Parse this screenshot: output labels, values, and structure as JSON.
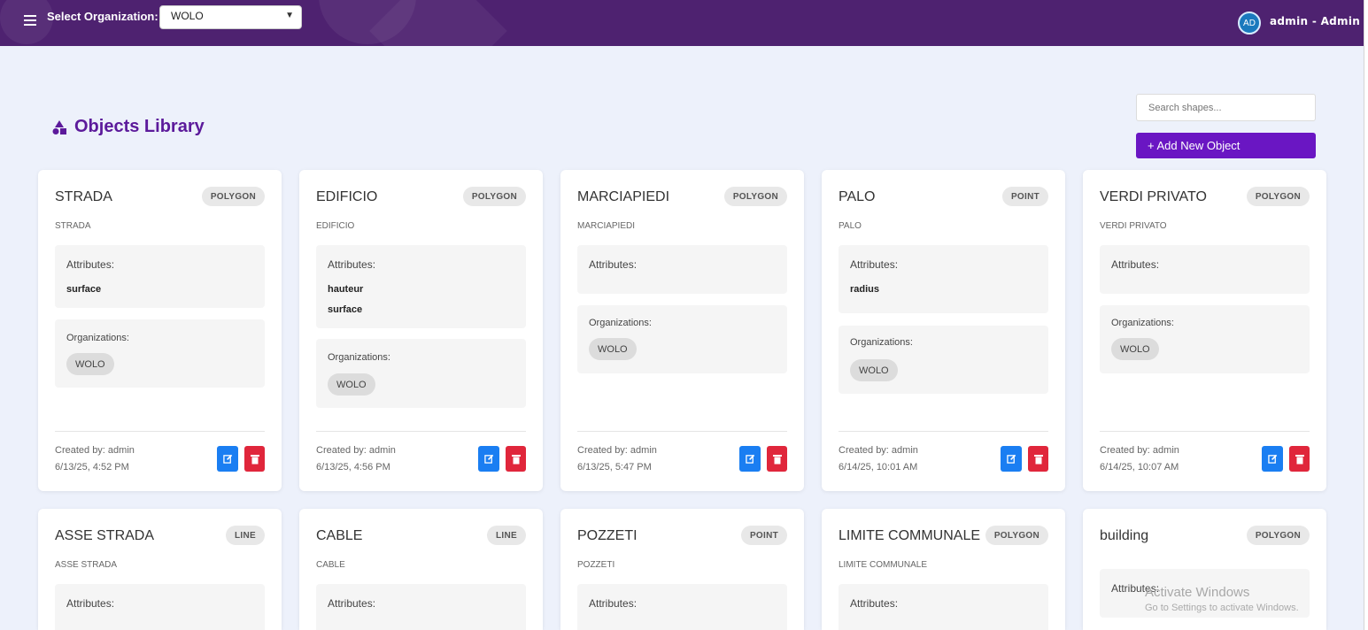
{
  "header": {
    "org_label": "Select Organization:",
    "org_selected": "WOLO",
    "user_avatar": "AD",
    "user_name": "admin - Admin"
  },
  "page": {
    "title": "Objects Library",
    "title_icon": "shapes-icon",
    "search_placeholder": "Search shapes...",
    "add_button": "+ Add New Object"
  },
  "labels": {
    "attributes": "Attributes:",
    "organizations": "Organizations:"
  },
  "cards": [
    {
      "name": "STRADA",
      "type": "POLYGON",
      "subname": "STRADA",
      "attributes": [
        "surface"
      ],
      "organizations": [
        "WOLO"
      ],
      "created_by": "Created by: admin",
      "date": "6/13/25, 4:52 PM"
    },
    {
      "name": "EDIFICIO",
      "type": "POLYGON",
      "subname": "EDIFICIO",
      "attributes": [
        "hauteur",
        "surface"
      ],
      "organizations": [
        "WOLO"
      ],
      "created_by": "Created by: admin",
      "date": "6/13/25, 4:56 PM"
    },
    {
      "name": "MARCIAPIEDI",
      "type": "POLYGON",
      "subname": "MARCIAPIEDI",
      "attributes": [],
      "organizations": [
        "WOLO"
      ],
      "created_by": "Created by: admin",
      "date": "6/13/25, 5:47 PM"
    },
    {
      "name": "PALO",
      "type": "POINT",
      "subname": "PALO",
      "attributes": [
        "radius"
      ],
      "organizations": [
        "WOLO"
      ],
      "created_by": "Created by: admin",
      "date": "6/14/25, 10:01 AM"
    },
    {
      "name": "VERDI PRIVATO",
      "type": "POLYGON",
      "subname": "VERDI PRIVATO",
      "attributes": [],
      "organizations": [
        "WOLO"
      ],
      "created_by": "Created by: admin",
      "date": "6/14/25, 10:07 AM"
    },
    {
      "name": "ASSE STRADA",
      "type": "LINE",
      "subname": "ASSE STRADA"
    },
    {
      "name": "CABLE",
      "type": "LINE",
      "subname": "CABLE"
    },
    {
      "name": "POZZETI",
      "type": "POINT",
      "subname": "POZZETI"
    },
    {
      "name": "LIMITE COMMUNALE",
      "type": "POLYGON",
      "subname": "LIMITE COMMUNALE"
    },
    {
      "name": "building",
      "type": "POLYGON",
      "subname": ""
    }
  ],
  "watermark": {
    "line1": "Activate Windows",
    "line2": "Go to Settings to activate Windows."
  },
  "colors": {
    "header_bg": "#4e2270",
    "accent": "#6a16c3",
    "title": "#5c1a9b",
    "edit": "#1a7ef2",
    "delete": "#e0263b"
  }
}
